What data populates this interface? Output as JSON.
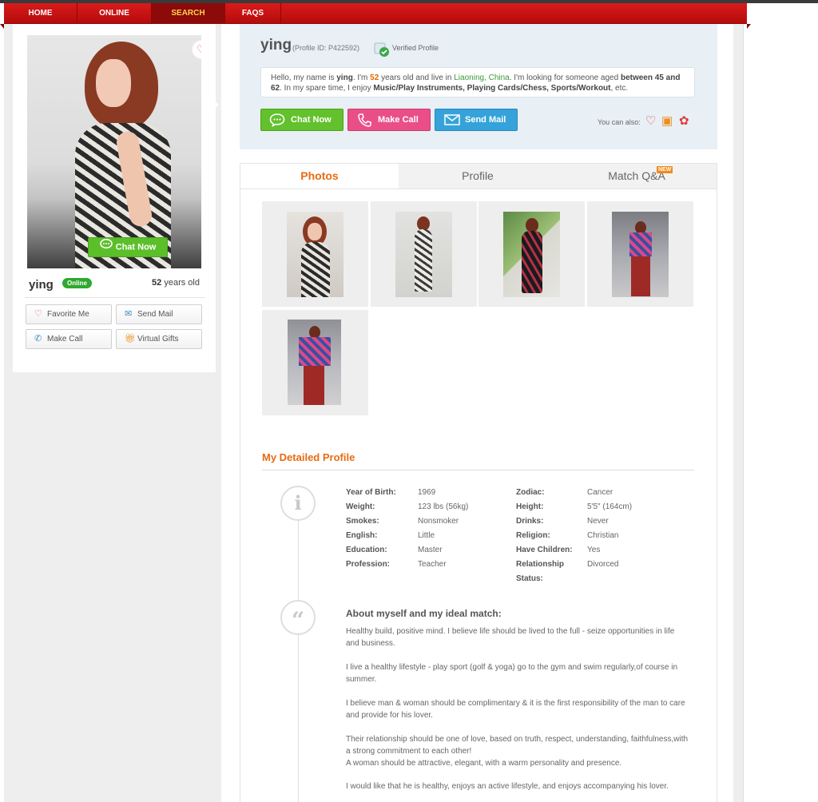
{
  "nav": {
    "items": [
      {
        "label": "HOME"
      },
      {
        "label": "ONLINE"
      },
      {
        "label": "SEARCH",
        "active": true
      },
      {
        "label": "FAQS"
      }
    ]
  },
  "sidebar": {
    "chat_label": "Chat Now",
    "name": "ying",
    "online_badge": "Online",
    "age_number": "52",
    "age_suffix": " years old",
    "buttons": {
      "favorite": "Favorite Me",
      "send_mail": "Send Mail",
      "make_call": "Make Call",
      "virtual_gifts": "Virtual Gifts"
    }
  },
  "header": {
    "name": "ying",
    "profile_id": "(Profile ID: P422592)",
    "verified": "Verified Profile",
    "intro": {
      "p1": "Hello, my name is ",
      "name": "ying",
      "p2": ". I'm ",
      "age": "52",
      "p3": " years old and live in ",
      "location": "Liaoning, China",
      "p4": ". I'm looking for someone aged ",
      "range": "between 45 and 62",
      "p5": ". In my spare time, I enjoy ",
      "hobbies": "Music/Play Instruments, Playing Cards/Chess, Sports/Workout",
      "p6": ", etc."
    },
    "buttons": {
      "chat": "Chat Now",
      "call": "Make Call",
      "mail": "Send Mail"
    },
    "also_label": "You can also:"
  },
  "tabs": {
    "photos": "Photos",
    "profile": "Profile",
    "match": "Match Q&A",
    "new_badge": "NEW"
  },
  "detail": {
    "title": "My Detailed Profile",
    "fields": [
      {
        "label": "Year of Birth:",
        "value": "1969"
      },
      {
        "label": "Weight:",
        "value": "123 lbs (56kg)"
      },
      {
        "label": "Smokes:",
        "value": "Nonsmoker"
      },
      {
        "label": "English:",
        "value": "Little"
      },
      {
        "label": "Education:",
        "value": "Master"
      },
      {
        "label": "Profession:",
        "value": "Teacher"
      },
      {
        "label": "Zodiac:",
        "value": "Cancer"
      },
      {
        "label": "Height:",
        "value": "5'5\" (164cm)"
      },
      {
        "label": "Drinks:",
        "value": "Never"
      },
      {
        "label": "Religion:",
        "value": "Christian"
      },
      {
        "label": "Have Children:",
        "value": "Yes"
      },
      {
        "label": "Relationship",
        "label2": "Status:",
        "value": "Divorced"
      }
    ],
    "about_title": "About myself and my ideal match:",
    "paragraphs": [
      "Healthy build, positive mind. I believe life should be lived to the full - seize opportunities in life and business.",
      "I live a healthy lifestyle - play sport (golf & yoga) go to the gym and swim regularly,of course in summer.",
      "I believe man & woman should be complimentary & it is the first responsibility of the man to care and provide for his lover.",
      "Their relationship should be one of love, based on truth, respect, understanding, faithfulness,with a strong commitment to each other!",
      "A woman should be attractive, elegant, with a warm personality and presence.",
      "I would like that he is healthy, enjoys an active lifestyle, and enjoys accompanying his lover."
    ]
  }
}
